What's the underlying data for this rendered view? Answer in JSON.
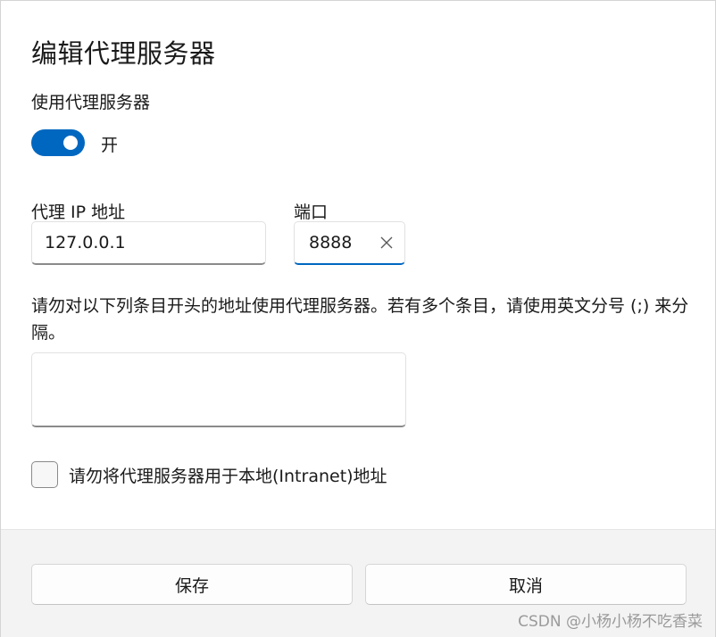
{
  "dialog": {
    "title": "编辑代理服务器",
    "use_proxy_label": "使用代理服务器",
    "toggle": {
      "state_label": "开",
      "on": true
    },
    "proxy_ip": {
      "label": "代理 IP 地址",
      "value": "127.0.0.1"
    },
    "port": {
      "label": "端口",
      "value": "8888"
    },
    "exceptions": {
      "description": "请勿对以下列条目开头的地址使用代理服务器。若有多个条目，请使用英文分号 (;) 来分隔。",
      "value": ""
    },
    "local_bypass": {
      "label": "请勿将代理服务器用于本地(Intranet)地址",
      "checked": false
    }
  },
  "footer": {
    "save_label": "保存",
    "cancel_label": "取消",
    "watermark": "CSDN @小杨小杨不吃香菜"
  },
  "icons": {
    "clear": "close-icon"
  },
  "colors": {
    "accent": "#0067c0",
    "footer_bg": "#f3f3f3"
  }
}
